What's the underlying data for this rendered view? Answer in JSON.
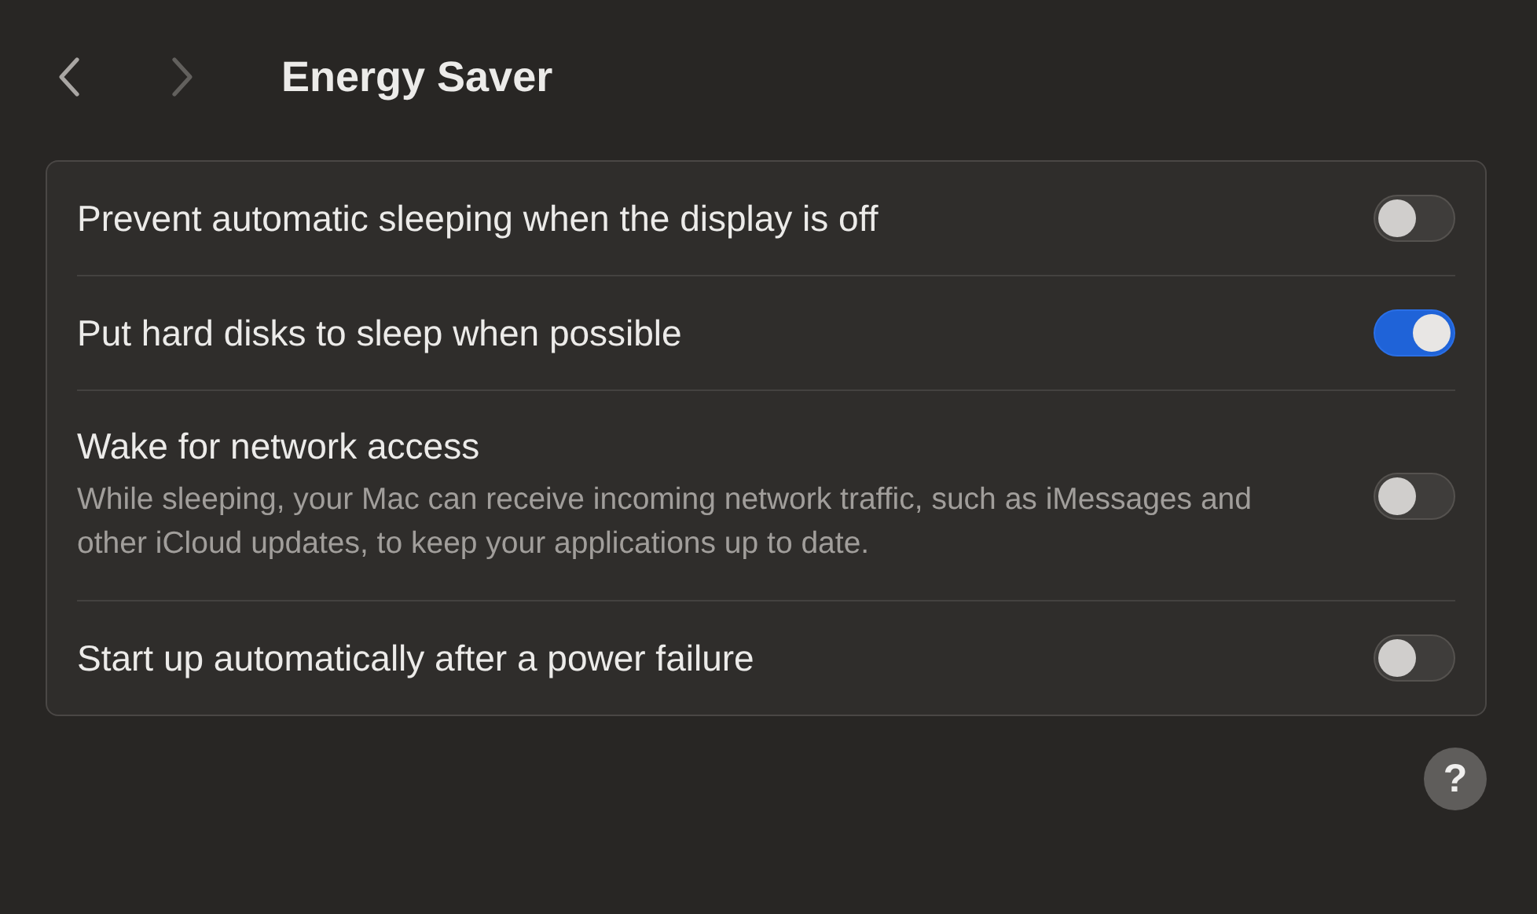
{
  "navigation": {
    "back": {
      "disabled": false
    },
    "forward": {
      "disabled": true
    }
  },
  "title": "Energy Saver",
  "settings": [
    {
      "label": "Prevent automatic sleeping when the display is off",
      "on": false
    },
    {
      "label": "Put hard disks to sleep when possible",
      "on": true
    },
    {
      "label": "Wake for network access",
      "description": "While sleeping, your Mac can receive incoming network traffic, such as iMessages and other iCloud updates, to keep your applications up to date.",
      "on": false
    },
    {
      "label": "Start up automatically after a power failure",
      "on": false
    }
  ],
  "help_button": "?"
}
